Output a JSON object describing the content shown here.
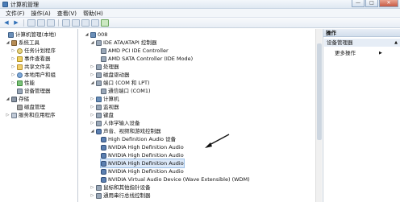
{
  "window": {
    "title": "计算机管理"
  },
  "window_buttons": {
    "minimize": "—",
    "maximize": "□",
    "close": "✕"
  },
  "menu": [
    "文件(F)",
    "操作(A)",
    "查看(V)",
    "帮助(H)"
  ],
  "toolbar_icons": [
    "back-arrow-icon",
    "forward-arrow-icon",
    "console-tree-icon",
    "properties-icon",
    "help-icon",
    "scan-hardware-icon",
    "update-driver-icon",
    "uninstall-icon",
    "disable-icon",
    "enable-icon"
  ],
  "left_tree": [
    {
      "label": "计算机管理(本地)",
      "icon": "computer-icon",
      "toggle": "",
      "level": 0
    },
    {
      "label": "系统工具",
      "icon": "tools-icon",
      "toggle": "◢",
      "level": 1
    },
    {
      "label": "任务计划程序",
      "icon": "clock-icon",
      "toggle": "▷",
      "level": 2
    },
    {
      "label": "事件查看器",
      "icon": "event-viewer-icon",
      "toggle": "▷",
      "level": 2
    },
    {
      "label": "共享文件夹",
      "icon": "shared-folder-icon",
      "toggle": "▷",
      "level": 2
    },
    {
      "label": "本地用户和组",
      "icon": "users-icon",
      "toggle": "▷",
      "level": 2
    },
    {
      "label": "性能",
      "icon": "performance-icon",
      "toggle": "▷",
      "level": 2
    },
    {
      "label": "设备管理器",
      "icon": "device-manager-icon",
      "toggle": "",
      "level": 2
    },
    {
      "label": "存储",
      "icon": "storage-icon",
      "toggle": "◢",
      "level": 1
    },
    {
      "label": "磁盘管理",
      "icon": "disk-icon",
      "toggle": "",
      "level": 2
    },
    {
      "label": "服务和应用程序",
      "icon": "services-icon",
      "toggle": "▷",
      "level": 1
    }
  ],
  "device_tree": [
    {
      "label": "008",
      "icon": "computer-icon",
      "toggle": "◢",
      "level": 0
    },
    {
      "label": "IDE ATA/ATAPI 控制器",
      "icon": "device-icon",
      "toggle": "◢",
      "level": 1
    },
    {
      "label": "AMD PCI IDE Controller",
      "icon": "device-icon",
      "toggle": "",
      "level": 2
    },
    {
      "label": "AMD SATA Controller (IDE Mode)",
      "icon": "device-icon",
      "toggle": "",
      "level": 2
    },
    {
      "label": "处理器",
      "icon": "device-icon",
      "toggle": "▷",
      "level": 1
    },
    {
      "label": "磁盘驱动器",
      "icon": "device-icon",
      "toggle": "▷",
      "level": 1
    },
    {
      "label": "端口 (COM 和 LPT)",
      "icon": "device-icon",
      "toggle": "◢",
      "level": 1
    },
    {
      "label": "通信端口 (COM1)",
      "icon": "device-icon",
      "toggle": "",
      "level": 2
    },
    {
      "label": "计算机",
      "icon": "computer-icon",
      "toggle": "▷",
      "level": 1
    },
    {
      "label": "监视器",
      "icon": "device-icon",
      "toggle": "▷",
      "level": 1
    },
    {
      "label": "键盘",
      "icon": "device-icon",
      "toggle": "▷",
      "level": 1
    },
    {
      "label": "人体学输入设备",
      "icon": "device-icon",
      "toggle": "▷",
      "level": 1
    },
    {
      "label": "声音、视频和游戏控制器",
      "icon": "sound-icon",
      "toggle": "◢",
      "level": 1
    },
    {
      "label": "High Definition Audio 设备",
      "icon": "sound-icon",
      "toggle": "",
      "level": 2
    },
    {
      "label": "NVIDIA High Definition Audio",
      "icon": "sound-icon",
      "toggle": "",
      "level": 2
    },
    {
      "label": "NVIDIA High Definition Audio",
      "icon": "sound-icon",
      "toggle": "",
      "level": 2
    },
    {
      "label": "NVIDIA High Definition Audio",
      "icon": "sound-icon",
      "toggle": "",
      "level": 2,
      "selected": true
    },
    {
      "label": "NVIDIA High Definition Audio",
      "icon": "sound-icon",
      "toggle": "",
      "level": 2
    },
    {
      "label": "NVIDIA Virtual Audio Device (Wave Extensible) (WDM)",
      "icon": "sound-icon",
      "toggle": "",
      "level": 2
    },
    {
      "label": "鼠标和其他指针设备",
      "icon": "device-icon",
      "toggle": "▷",
      "level": 1
    },
    {
      "label": "通用串行总线控制器",
      "icon": "device-icon",
      "toggle": "▷",
      "level": 1
    }
  ],
  "actions": {
    "header": "操作",
    "section": "设备管理器",
    "more": "更多操作"
  },
  "annotation_arrow_icon": "annotation-arrow-icon"
}
